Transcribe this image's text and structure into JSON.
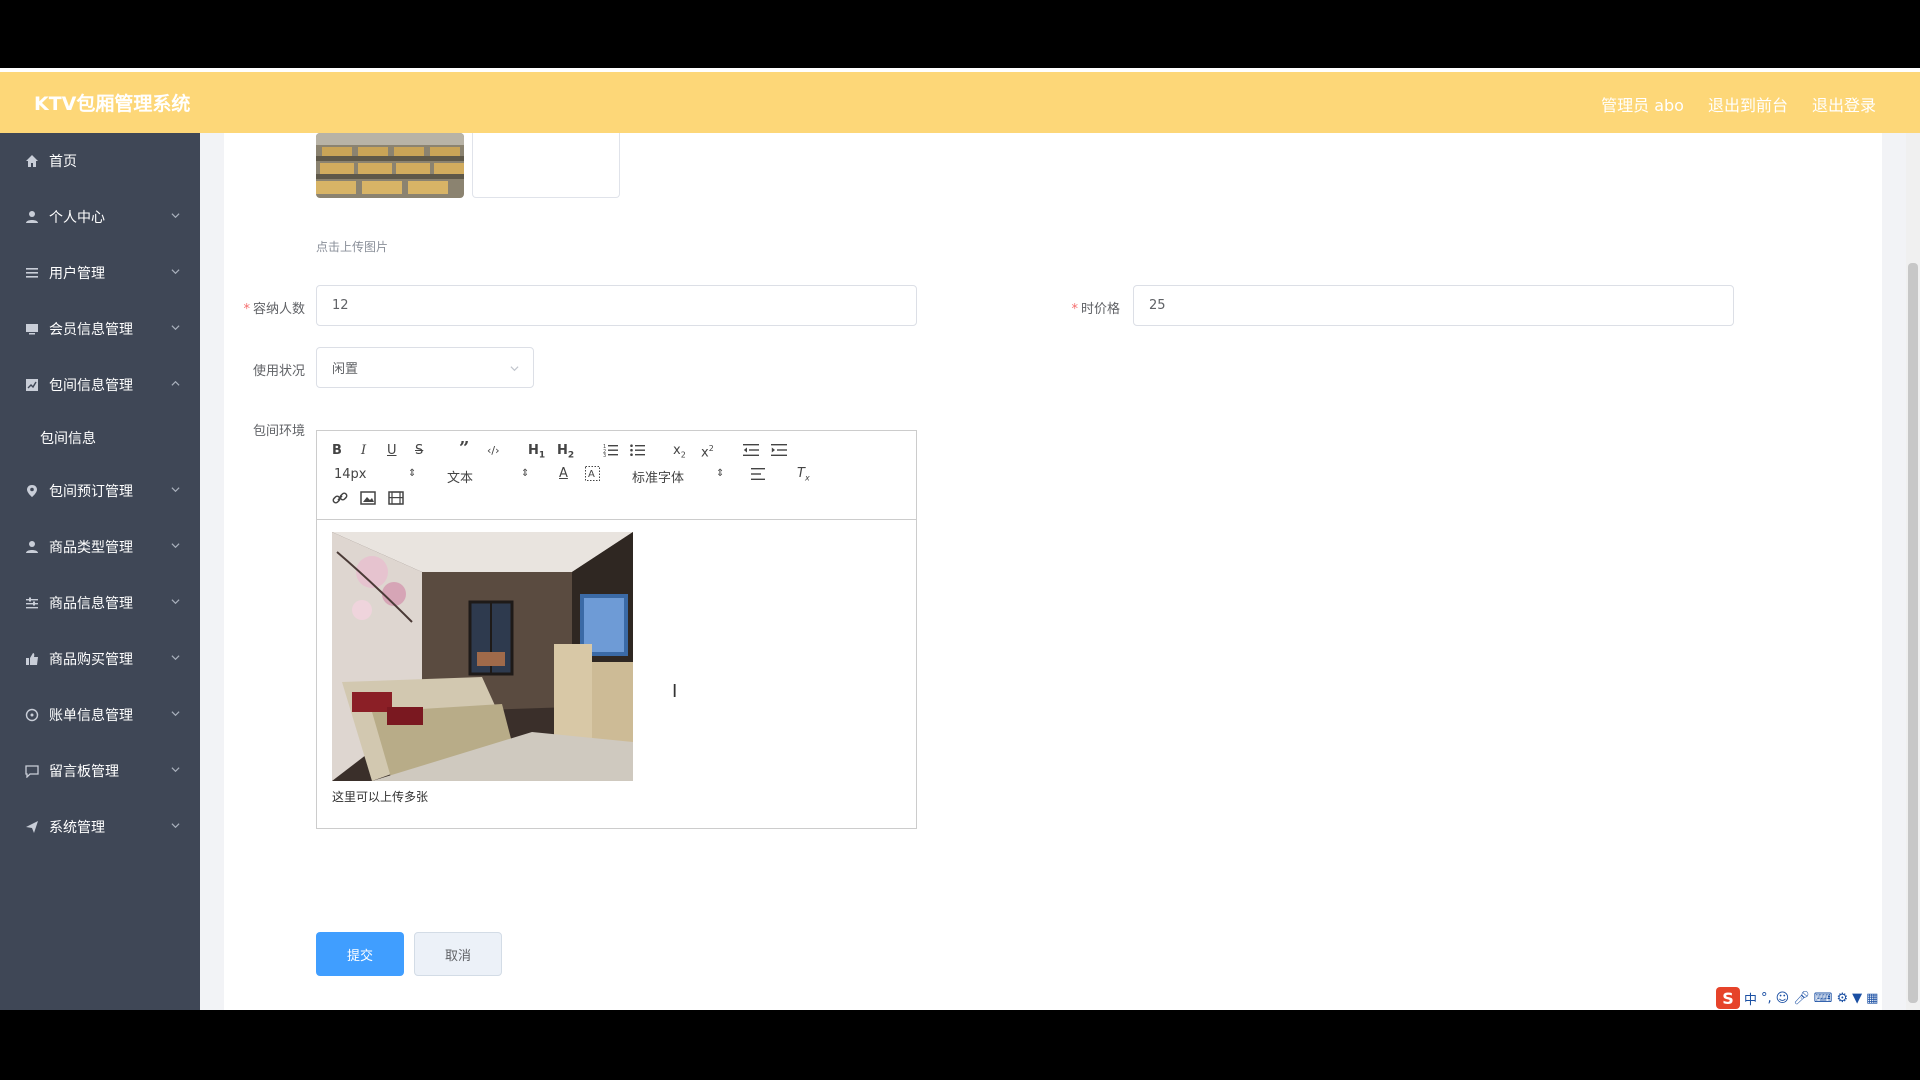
{
  "header": {
    "title": "KTV包厢管理系统",
    "admin_label": "管理员 abo",
    "back_label": "退出到前台",
    "logout_label": "退出登录"
  },
  "sidebar": {
    "items": [
      {
        "label": "首页",
        "icon": "home-icon"
      },
      {
        "label": "个人中心",
        "icon": "user-icon"
      },
      {
        "label": "用户管理",
        "icon": "list-icon"
      },
      {
        "label": "会员信息管理",
        "icon": "monitor-icon"
      },
      {
        "label": "包间信息管理",
        "icon": "chart-icon"
      },
      {
        "label": "包间信息",
        "icon": ""
      },
      {
        "label": "包间预订管理",
        "icon": "location-icon"
      },
      {
        "label": "商品类型管理",
        "icon": "user-icon"
      },
      {
        "label": "商品信息管理",
        "icon": "sliders-icon"
      },
      {
        "label": "商品购买管理",
        "icon": "thumb-icon"
      },
      {
        "label": "账单信息管理",
        "icon": "compass-icon"
      },
      {
        "label": "留言板管理",
        "icon": "chat-icon"
      },
      {
        "label": "系统管理",
        "icon": "send-icon"
      }
    ]
  },
  "form": {
    "upload_hint": "点击上传图片",
    "capacity_label": "容纳人数",
    "capacity_value": "12",
    "price_label": "时价格",
    "price_value": "25",
    "status_label": "使用状况",
    "status_value": "闲置",
    "env_label": "包间环境",
    "editor": {
      "font_size": "14px",
      "block_format": "文本",
      "font_family": "标准字体",
      "body_text": "这里可以上传多张"
    },
    "submit_label": "提交",
    "cancel_label": "取消"
  },
  "ime": {
    "logo": "S",
    "mode": "中"
  },
  "colors": {
    "header_bg": "#fdd778",
    "sidebar_bg": "#3f4756",
    "primary": "#409eff"
  }
}
